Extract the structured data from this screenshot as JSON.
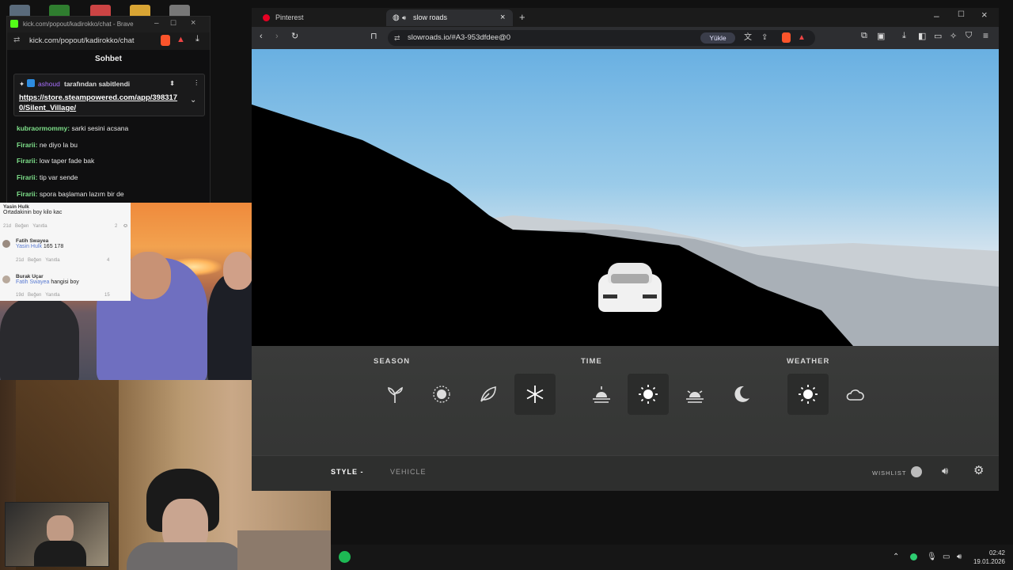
{
  "chat_window": {
    "title": "kick.com/popout/kadirokko/chat - Brave",
    "url": "kick.com/popout/kadirokko/chat",
    "header": "Sohbet",
    "pinned": {
      "user": "ashoud",
      "text": "tarafından sabitlendi",
      "link": "https://store.steampowered.com/app/3983170/Silent_Village/",
      "link_line1": "https://store.steampowered.com/app/398317",
      "link_line2": "0/Silent_Village/"
    },
    "messages": [
      {
        "user": "kubraormommy:",
        "text": "sarki sesini acsana"
      },
      {
        "user": "Firarii:",
        "text": "ne diyo la bu"
      },
      {
        "user": "Firarii:",
        "text": "low taper fade bak"
      },
      {
        "user": "Firarii:",
        "text": "tip var sende"
      },
      {
        "user": "Firarii:",
        "text": "spora başlaman lazım bir de"
      }
    ]
  },
  "tiktok": {
    "comments": [
      {
        "name": "Yasin Hulk",
        "text": "Ortadakinin boy kilo kac",
        "age": "21d",
        "like": "Beğen",
        "reply": "Yanıtla",
        "count": "2"
      },
      {
        "name": "Fatih Swayea",
        "mention": "Yasin Hulk",
        "text": "165 178",
        "age": "21d",
        "like": "Beğen",
        "reply": "Yanıtla",
        "count": "4"
      },
      {
        "name": "Burak Uçar",
        "mention": "Fatih Swayea",
        "text": "hangisi boy",
        "age": "19d",
        "like": "Beğen",
        "reply": "Yanıtla",
        "count": "15"
      }
    ]
  },
  "browser": {
    "tabs": [
      {
        "label": "Pinterest"
      },
      {
        "label": "slow roads"
      }
    ],
    "url": "slowroads.io/#A3-953dfdee@0",
    "load_label": "Yükle"
  },
  "game": {
    "sections": {
      "season": "SEASON",
      "time": "TIME",
      "weather": "WEATHER"
    },
    "season_options": [
      "spring-icon",
      "summer-icon",
      "autumn-icon",
      "winter-icon"
    ],
    "season_selected": "winter",
    "time_options": [
      "sunrise-icon",
      "day-icon",
      "sunset-icon",
      "night-icon"
    ],
    "time_selected": "day",
    "weather_options": [
      "clear-icon",
      "cloudy-icon"
    ],
    "weather_selected": "clear",
    "bottom": {
      "style_label": "STYLE -",
      "vehicle_label": "VEHICLE",
      "wishlist_label": "WISHLIST"
    }
  },
  "taskbar": {
    "time": "02:42",
    "date": "19.01.2026"
  },
  "colors": {
    "sky_top": "#69b0e2",
    "panel_bg": "#3a3b3a",
    "chat_username": "#7ee08a",
    "pinned_user": "#a970ff"
  }
}
